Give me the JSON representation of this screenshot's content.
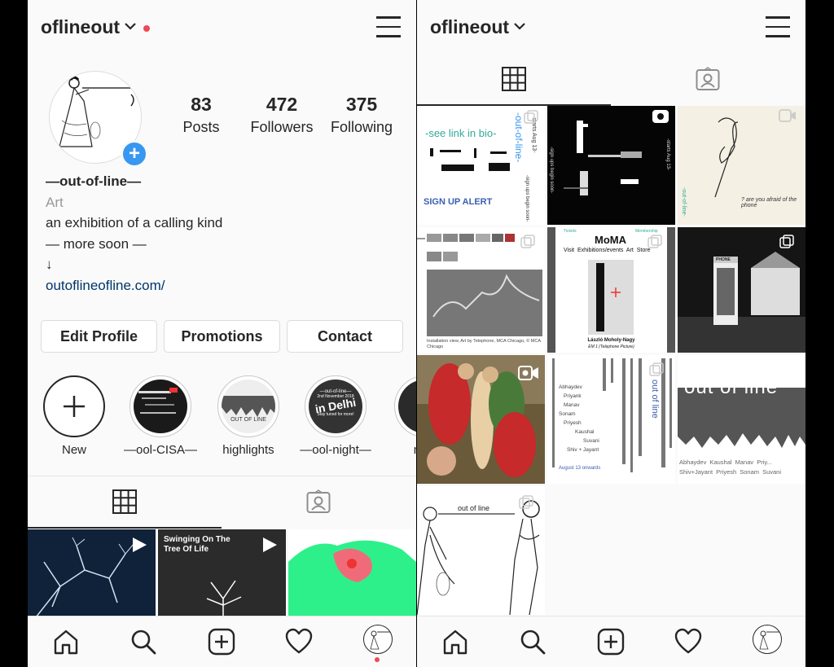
{
  "profile": {
    "username": "oflineout",
    "stats": [
      {
        "value": "83",
        "label": "Posts"
      },
      {
        "value": "472",
        "label": "Followers"
      },
      {
        "value": "375",
        "label": "Following"
      }
    ],
    "name": "—out-of-line—",
    "category": "Art",
    "bio_lines": [
      "an exhibition of a calling kind",
      "— more soon —",
      "↓"
    ],
    "link": "outoflineofline.com/"
  },
  "buttons": {
    "edit": "Edit Profile",
    "promotions": "Promotions",
    "contact": "Contact"
  },
  "highlights": [
    {
      "label": "New"
    },
    {
      "label": "—ool-CISA—"
    },
    {
      "label": "highlights"
    },
    {
      "label": "—ool-night—"
    },
    {
      "label": "m"
    }
  ],
  "highlight_art": {
    "hl2_text": "OUT OF LINE",
    "hl3_top": "—out-of-line—",
    "hl3_date": "2nd November 2018",
    "hl3_city": "in Delhi",
    "hl3_sub": "Stay tuned for more!"
  },
  "left_tiles": {
    "t2_caption": "Swinging On The Tree Of Life"
  },
  "right_tiles": {
    "r1_link": "-see link in bio-",
    "r1_vertical": "-out-of-line-",
    "r1_date": "-starts Aug 13-",
    "r1_signup": "SIGN UP ALERT",
    "r1_soon": "-sign ups begin soon-",
    "r2_text": "-sign ups begin soon-",
    "r2_text2": "-starts Aug 13-",
    "r3_text": "-out-of-line-",
    "r3_scribble": "? are you afraid of the phone",
    "r4_caption": "Installation view, Art by Telephone, MCA Chicago, © MCA Chicago",
    "r5_brand": "MoMA",
    "r5_nav": "Visit  Exhibitions/events  Art  Store",
    "r5_tickets": "Tickets",
    "r5_membership": "Membership",
    "r5_artist": "László Moholy-Nagy",
    "r5_work": "EM 1 (Telephone Picture)",
    "r6_sign": "PHONE",
    "r8_names": [
      "Abhaydev",
      "Priyank",
      "Manav",
      "Sonam",
      "Priyesh",
      "Kaushal",
      "Suvani",
      "Shiv + Jayant"
    ],
    "r8_title": "out of line",
    "r8_date": "August 13 onwards",
    "r9_title": "out of line",
    "r9_names": "Abhaydev  Kaushal  Manav  Priy... Shiv+Jayant  Priyesh  Sonam  Suvani",
    "r10_title": "out of line"
  },
  "colors": {
    "link": "#003569",
    "accent_blue": "#3897f0",
    "notification_red": "#ed4956",
    "divider": "#dbdbdb"
  }
}
